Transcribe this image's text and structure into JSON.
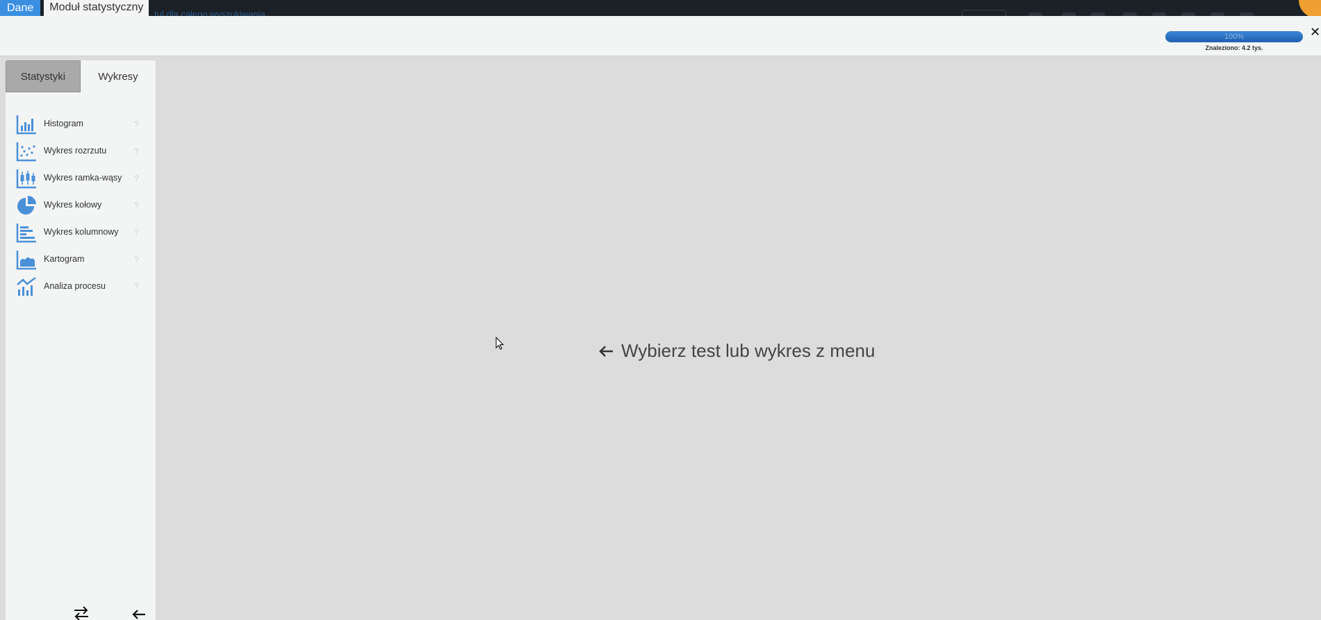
{
  "app": {
    "done_label": "Dane",
    "module_title": "Moduł statystyczny"
  },
  "topbar": {
    "background_text": "tul dla całego wyszukiwania"
  },
  "header": {
    "progress_percent": 100,
    "progress_label": "100%",
    "found_label": "Znaleziono: 4.2 tys.",
    "close_symbol": "✕"
  },
  "sidebar": {
    "tabs": [
      {
        "label": "Statystyki",
        "active": true
      },
      {
        "label": "Wykresy",
        "active": false
      }
    ],
    "items": [
      {
        "label": "Histogram",
        "icon": "histogram-icon",
        "help": "?"
      },
      {
        "label": "Wykres rozrzutu",
        "icon": "scatter-plot-icon",
        "help": "?"
      },
      {
        "label": "Wykres ramka-wąsy",
        "icon": "box-plot-icon",
        "help": "?"
      },
      {
        "label": "Wykres kołowy",
        "icon": "pie-chart-icon",
        "help": "?"
      },
      {
        "label": "Wykres kolumnowy",
        "icon": "column-chart-icon",
        "help": "?"
      },
      {
        "label": "Kartogram",
        "icon": "area-map-icon",
        "help": "?"
      },
      {
        "label": "Analiza procesu",
        "icon": "process-analysis-icon",
        "help": "?"
      }
    ]
  },
  "main": {
    "placeholder": "Wybierz test lub wykres z menu"
  },
  "colors": {
    "accent": "#3a8fe0",
    "icon_blue": "#4a90d9",
    "progress": "#1f5fae"
  }
}
